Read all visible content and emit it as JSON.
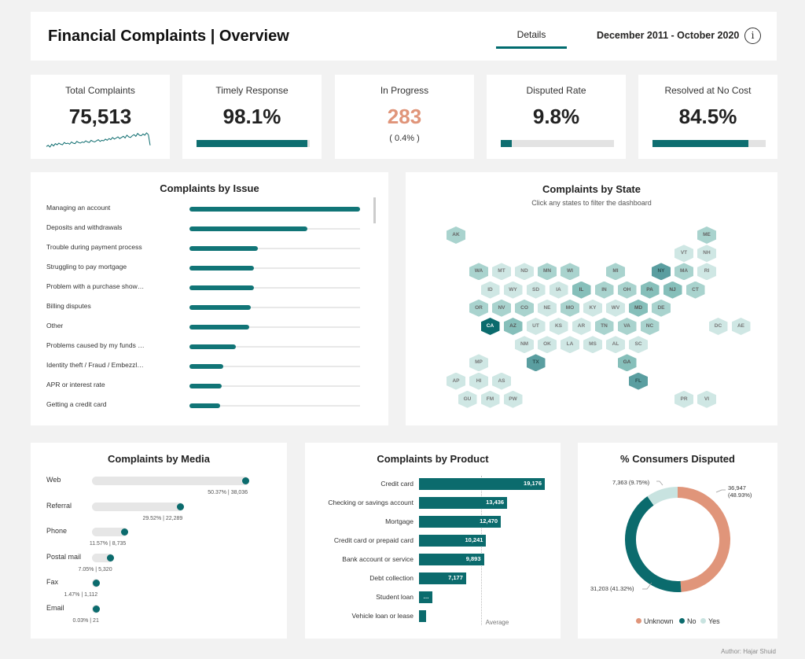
{
  "header": {
    "title": "Financial Complaints | Overview",
    "tab_label": "Details",
    "date_range": "December 2011 - October 2020",
    "info_glyph": "i"
  },
  "kpis": [
    {
      "label": "Total Complaints",
      "value": "75,513"
    },
    {
      "label": "Timely Response",
      "value": "98.1%",
      "bar_fraction": 0.981
    },
    {
      "label": "In Progress",
      "value": "283",
      "sub": "( 0.4% )"
    },
    {
      "label": "Disputed Rate",
      "value": "9.8%",
      "bar_fraction": 0.098
    },
    {
      "label": "Resolved at No Cost",
      "value": "84.5%",
      "bar_fraction": 0.845
    }
  ],
  "colors": {
    "teal": "#0b6b6d",
    "in_progress": "#e0957a",
    "unknown": "#e0957a",
    "no": "#0b6b6d",
    "yes": "#c8e3e0"
  },
  "issue": {
    "title": "Complaints by Issue"
  },
  "state": {
    "title": "Complaints by State",
    "subtitle": "Click any states to filter the dashboard"
  },
  "media": {
    "title": "Complaints by Media"
  },
  "product": {
    "title": "Complaints by Product",
    "average_label": "Average"
  },
  "disputed": {
    "title": "% Consumers Disputed",
    "legend": [
      {
        "label": "Unknown",
        "color": "#e0957a"
      },
      {
        "label": "No",
        "color": "#0b6b6d"
      },
      {
        "label": "Yes",
        "color": "#c8e3e0"
      }
    ],
    "annotations": {
      "unknown_line1": "36,947",
      "unknown_line2": "(48.93%)",
      "no": "31,203 (41.32%)",
      "yes": "7,363 (9.75%)"
    }
  },
  "footer": {
    "author": "Author: Hajar Shuid"
  },
  "chart_data": [
    {
      "type": "line",
      "title": "Total Complaints",
      "description_note": "",
      "values": [
        10,
        12,
        9,
        14,
        11,
        15,
        13,
        16,
        14,
        13,
        17,
        15,
        16,
        14,
        18,
        16,
        15,
        19,
        17,
        16,
        18,
        17,
        20,
        18,
        17,
        21,
        19,
        18,
        20,
        22,
        19,
        21,
        20,
        23,
        21,
        24,
        22,
        26,
        23,
        25,
        27,
        24,
        26,
        28,
        25,
        30,
        27,
        26,
        29,
        31,
        28,
        33,
        30,
        29,
        32,
        30,
        34,
        31,
        12
      ]
    },
    {
      "type": "bar",
      "title": "Complaints by Issue",
      "categories": [
        "Managing an account",
        "Deposits and withdrawals",
        "Trouble during payment process",
        "Struggling to pay mortgage",
        "Problem with a purchase show…",
        "Billing disputes",
        "Other",
        "Problems caused by my funds …",
        "Identity theft / Fraud / Embezzl…",
        "APR or interest rate",
        "Getting a credit card"
      ],
      "values": [
        100,
        69,
        40,
        38,
        38,
        36,
        35,
        27,
        20,
        19,
        18
      ]
    },
    {
      "type": "heatmap",
      "title": "Complaints by State",
      "states": [
        {
          "code": "AK",
          "col": 0,
          "row": 0,
          "level": 1
        },
        {
          "code": "ME",
          "col": 11,
          "row": 0,
          "level": 1
        },
        {
          "code": "VT",
          "col": 10,
          "row": 1,
          "level": 0
        },
        {
          "code": "NH",
          "col": 11,
          "row": 1,
          "level": 0
        },
        {
          "code": "WA",
          "col": 1,
          "row": 2,
          "level": 1
        },
        {
          "code": "MT",
          "col": 2,
          "row": 2,
          "level": 0
        },
        {
          "code": "ND",
          "col": 3,
          "row": 2,
          "level": 0
        },
        {
          "code": "MN",
          "col": 4,
          "row": 2,
          "level": 1
        },
        {
          "code": "WI",
          "col": 5,
          "row": 2,
          "level": 1
        },
        {
          "code": "MI",
          "col": 7,
          "row": 2,
          "level": 1
        },
        {
          "code": "NY",
          "col": 9,
          "row": 2,
          "level": 3
        },
        {
          "code": "MA",
          "col": 10,
          "row": 2,
          "level": 1
        },
        {
          "code": "RI",
          "col": 11,
          "row": 2,
          "level": 0
        },
        {
          "code": "ID",
          "col": 1.5,
          "row": 3,
          "level": 0
        },
        {
          "code": "WY",
          "col": 2.5,
          "row": 3,
          "level": 0
        },
        {
          "code": "SD",
          "col": 3.5,
          "row": 3,
          "level": 0
        },
        {
          "code": "IA",
          "col": 4.5,
          "row": 3,
          "level": 0
        },
        {
          "code": "IL",
          "col": 5.5,
          "row": 3,
          "level": 2
        },
        {
          "code": "IN",
          "col": 6.5,
          "row": 3,
          "level": 1
        },
        {
          "code": "OH",
          "col": 7.5,
          "row": 3,
          "level": 1
        },
        {
          "code": "PA",
          "col": 8.5,
          "row": 3,
          "level": 2
        },
        {
          "code": "NJ",
          "col": 9.5,
          "row": 3,
          "level": 2
        },
        {
          "code": "CT",
          "col": 10.5,
          "row": 3,
          "level": 1
        },
        {
          "code": "OR",
          "col": 1,
          "row": 4,
          "level": 1
        },
        {
          "code": "NV",
          "col": 2,
          "row": 4,
          "level": 1
        },
        {
          "code": "CO",
          "col": 3,
          "row": 4,
          "level": 1
        },
        {
          "code": "NE",
          "col": 4,
          "row": 4,
          "level": 0
        },
        {
          "code": "MO",
          "col": 5,
          "row": 4,
          "level": 1
        },
        {
          "code": "KY",
          "col": 6,
          "row": 4,
          "level": 0
        },
        {
          "code": "WV",
          "col": 7,
          "row": 4,
          "level": 0
        },
        {
          "code": "MD",
          "col": 8,
          "row": 4,
          "level": 2
        },
        {
          "code": "DE",
          "col": 9,
          "row": 4,
          "level": 1
        },
        {
          "code": "CA",
          "col": 1.5,
          "row": 5,
          "level": 4
        },
        {
          "code": "AZ",
          "col": 2.5,
          "row": 5,
          "level": 2
        },
        {
          "code": "UT",
          "col": 3.5,
          "row": 5,
          "level": 0
        },
        {
          "code": "KS",
          "col": 4.5,
          "row": 5,
          "level": 0
        },
        {
          "code": "AR",
          "col": 5.5,
          "row": 5,
          "level": 0
        },
        {
          "code": "TN",
          "col": 6.5,
          "row": 5,
          "level": 1
        },
        {
          "code": "VA",
          "col": 7.5,
          "row": 5,
          "level": 1
        },
        {
          "code": "NC",
          "col": 8.5,
          "row": 5,
          "level": 1
        },
        {
          "code": "DC",
          "col": 11.5,
          "row": 5,
          "level": 0
        },
        {
          "code": "AE",
          "col": 12.5,
          "row": 5,
          "level": 0
        },
        {
          "code": "NM",
          "col": 3,
          "row": 6,
          "level": 0
        },
        {
          "code": "OK",
          "col": 4,
          "row": 6,
          "level": 0
        },
        {
          "code": "LA",
          "col": 5,
          "row": 6,
          "level": 0
        },
        {
          "code": "MS",
          "col": 6,
          "row": 6,
          "level": 0
        },
        {
          "code": "AL",
          "col": 7,
          "row": 6,
          "level": 0
        },
        {
          "code": "SC",
          "col": 8,
          "row": 6,
          "level": 0
        },
        {
          "code": "MP",
          "col": 1,
          "row": 7,
          "level": 0
        },
        {
          "code": "TX",
          "col": 3.5,
          "row": 7,
          "level": 3
        },
        {
          "code": "GA",
          "col": 7.5,
          "row": 7,
          "level": 2
        },
        {
          "code": "AP",
          "col": 0,
          "row": 8,
          "level": 0
        },
        {
          "code": "HI",
          "col": 1,
          "row": 8,
          "level": 0
        },
        {
          "code": "AS",
          "col": 2,
          "row": 8,
          "level": 0
        },
        {
          "code": "FL",
          "col": 8,
          "row": 8,
          "level": 3
        },
        {
          "code": "GU",
          "col": 0.5,
          "row": 9,
          "level": 0
        },
        {
          "code": "FM",
          "col": 1.5,
          "row": 9,
          "level": 0
        },
        {
          "code": "PW",
          "col": 2.5,
          "row": 9,
          "level": 0
        },
        {
          "code": "PR",
          "col": 10,
          "row": 9,
          "level": 0
        },
        {
          "code": "VI",
          "col": 11,
          "row": 9,
          "level": 0
        }
      ]
    },
    {
      "type": "bar",
      "title": "Complaints by Media",
      "categories": [
        "Web",
        "Referral",
        "Phone",
        "Postal mail",
        "Fax",
        "Email"
      ],
      "values": [
        38036,
        22289,
        8735,
        5320,
        1112,
        21
      ],
      "labels": [
        "50.37% | 38,036",
        "29.52% | 22,289",
        "11.57% | 8,735",
        "7.05% | 5,320",
        "1.47% | 1,112",
        "0.03% | 21"
      ]
    },
    {
      "type": "bar",
      "title": "Complaints by Product",
      "categories": [
        "Credit card",
        "Checking or savings account",
        "Mortgage",
        "Credit card or prepaid card",
        "Bank account or service",
        "Debt collection",
        "Student loan",
        "Vehicle loan or lease"
      ],
      "values": [
        19176,
        13436,
        12470,
        10241,
        9893,
        7177,
        2000,
        1050
      ],
      "labels": [
        "19,176",
        "13,436",
        "12,470",
        "10,241",
        "9,893",
        "7,177",
        "…",
        ""
      ],
      "average_value": 9430
    },
    {
      "type": "pie",
      "title": "% Consumers Disputed",
      "categories": [
        "Unknown",
        "No",
        "Yes"
      ],
      "values": [
        36947,
        31203,
        7363
      ],
      "percentages": [
        48.93,
        41.32,
        9.75
      ]
    }
  ]
}
